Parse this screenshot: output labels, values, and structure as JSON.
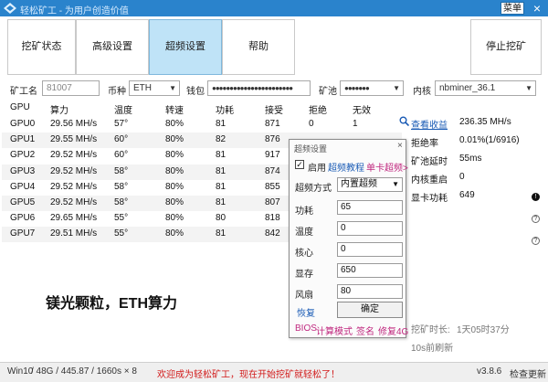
{
  "app": {
    "title": "轻松矿工 - 为用户创造价值",
    "menu_label": "菜单",
    "close_glyph": "×"
  },
  "nav": {
    "tabs": [
      {
        "label": "挖矿状态",
        "active": false
      },
      {
        "label": "高级设置",
        "active": false
      },
      {
        "label": "超频设置",
        "active": true
      },
      {
        "label": "帮助",
        "active": false
      }
    ],
    "stop_label": "停止挖矿"
  },
  "config": {
    "worker_label": "矿工名",
    "worker_value": "81007",
    "coin_label": "币种",
    "coin_value": "ETH",
    "wallet_label": "钱包",
    "wallet_value": "●●●●●●●●●●●●●●●●●●●●●●●",
    "pool_label": "矿池",
    "pool_value": "●●●●●●●",
    "kernel_label": "内核",
    "kernel_value": "nbminer_36.1"
  },
  "table": {
    "headers": [
      "GPU",
      "算力",
      "温度",
      "转速",
      "功耗",
      "接受",
      "拒绝",
      "无效"
    ],
    "rows": [
      [
        "GPU0",
        "29.56 MH/s",
        "57°",
        "80%",
        "81",
        "871",
        "0",
        "1"
      ],
      [
        "GPU1",
        "29.55 MH/s",
        "60°",
        "80%",
        "82",
        "876",
        "",
        ""
      ],
      [
        "GPU2",
        "29.52 MH/s",
        "60°",
        "80%",
        "81",
        "917",
        "",
        ""
      ],
      [
        "GPU3",
        "29.52 MH/s",
        "58°",
        "80%",
        "81",
        "874",
        "",
        ""
      ],
      [
        "GPU4",
        "29.52 MH/s",
        "58°",
        "80%",
        "81",
        "855",
        "",
        ""
      ],
      [
        "GPU5",
        "29.52 MH/s",
        "58°",
        "80%",
        "81",
        "807",
        "",
        ""
      ],
      [
        "GPU6",
        "29.65 MH/s",
        "55°",
        "80%",
        "80",
        "818",
        "",
        ""
      ],
      [
        "GPU7",
        "29.51 MH/s",
        "55°",
        "80%",
        "81",
        "842",
        "",
        ""
      ]
    ]
  },
  "stats": {
    "income_link": "查看收益",
    "hashrate": "236.35 MH/s",
    "reject_label": "拒绝率",
    "reject_value": "0.01%(1/6916)",
    "latency_label": "矿池延时",
    "latency_value": "55ms",
    "restart_label": "内核重启",
    "restart_value": "0",
    "power_label": "显卡功耗",
    "power_value": "649",
    "duration_label": "挖矿时长:",
    "duration_value": "1天05时37分",
    "refresh_text": "10s前刷新"
  },
  "overclock": {
    "title": "超频设置",
    "enable_label": "启用",
    "tutorial_link": "超频教程",
    "single_card_link": "单卡超频>",
    "mode_label": "超频方式",
    "mode_value": "内置超频",
    "fields": [
      {
        "label": "功耗",
        "value": "65"
      },
      {
        "label": "温度",
        "value": "0"
      },
      {
        "label": "核心",
        "value": "0"
      },
      {
        "label": "显存",
        "value": "650"
      },
      {
        "label": "风扇",
        "value": "80"
      }
    ],
    "restore_label": "恢复",
    "confirm_label": "确定",
    "footer_links": [
      "BIOS",
      "计算模式",
      "签名",
      "修复4G"
    ]
  },
  "overlay_caption": "镁光颗粒，ETH算力",
  "statusbar": {
    "os": "Win10",
    "hw": "/ 48G / 445.87 / 1660s × 8",
    "message": "欢迎成为轻松矿工，现在开始挖矿就轻松了！",
    "version": "v3.8.6",
    "update": "检查更新"
  },
  "colors": {
    "titlebar": "#2a83cc",
    "active_tab": "#bfe3f7",
    "link": "#1a5bb5",
    "overclock_accent": "#c0287f",
    "status_message": "#d21a1a"
  }
}
